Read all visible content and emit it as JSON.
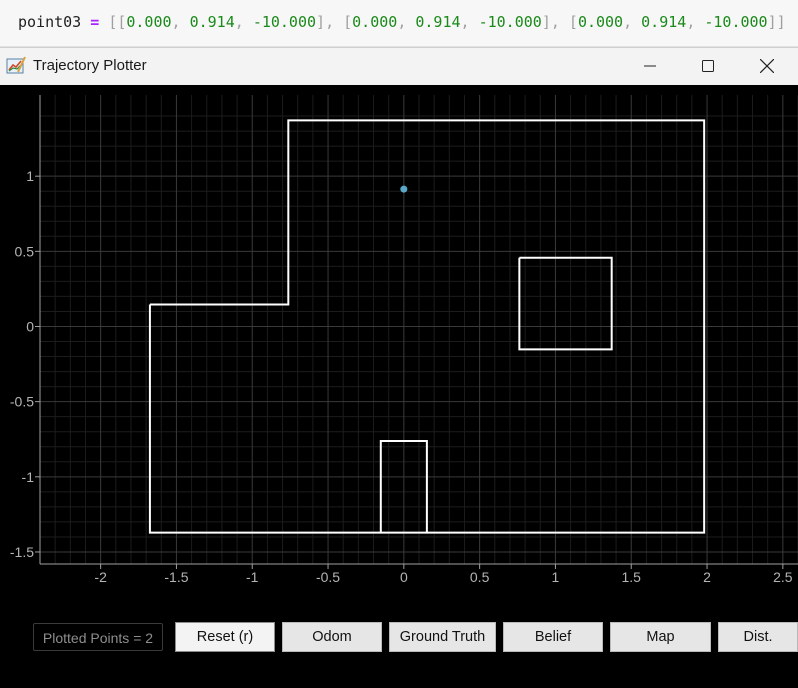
{
  "code_line": {
    "var": "point03",
    "op": " = ",
    "points": [
      [
        "0.000",
        "0.914",
        "-10.000"
      ],
      [
        "0.000",
        "0.914",
        "-10.000"
      ],
      [
        "0.000",
        "0.914",
        "-10.000"
      ]
    ]
  },
  "window": {
    "title": "Trajectory Plotter",
    "app_icon": "chart-pen-icon",
    "controls": [
      "minimize-icon",
      "maximize-icon",
      "close-icon"
    ]
  },
  "chart_data": {
    "type": "line",
    "xlim": [
      -2.4,
      2.6
    ],
    "ylim": [
      -1.58,
      1.54
    ],
    "x_ticks": [
      -2,
      -1.5,
      -1,
      -0.5,
      0,
      0.5,
      1,
      1.5,
      2,
      2.5
    ],
    "x_tick_labels": [
      "-2",
      "-1.5",
      "-1",
      "-0.5",
      "0",
      "0.5",
      "1",
      "1.5",
      "2",
      "2.5"
    ],
    "y_ticks": [
      1,
      0.5,
      0,
      -0.5,
      -1,
      -1.5
    ],
    "y_tick_labels": [
      "1",
      "0.5",
      "0",
      "-0.5",
      "-1",
      "-1.5"
    ],
    "grid": true,
    "map_lines": [
      [
        [
          -1.675,
          0.146
        ],
        [
          -0.762,
          0.146
        ],
        [
          -0.762,
          1.371
        ],
        [
          1.981,
          1.371
        ],
        [
          1.981,
          -1.371
        ],
        [
          -1.675,
          -1.371
        ],
        [
          -1.675,
          0.146
        ]
      ],
      [
        [
          0.762,
          0.457
        ],
        [
          1.371,
          0.457
        ],
        [
          1.371,
          -0.152
        ],
        [
          0.762,
          -0.152
        ],
        [
          0.762,
          0.457
        ]
      ],
      [
        [
          -0.152,
          -1.371
        ],
        [
          -0.152,
          -0.762
        ],
        [
          0.152,
          -0.762
        ],
        [
          0.152,
          -1.371
        ]
      ]
    ],
    "points": [
      {
        "x": 0.0,
        "y": 0.914
      }
    ],
    "colors": {
      "background": "#000000",
      "grid": "#3a3a3a",
      "axis": "#a0a0a0",
      "map": "#ffffff",
      "point": "#5aa8c8"
    }
  },
  "controls": {
    "status": "Plotted Points = 2",
    "buttons": [
      {
        "name": "reset-button",
        "label": "Reset (r)"
      },
      {
        "name": "odom-button",
        "label": "Odom"
      },
      {
        "name": "ground-truth-button",
        "label": "Ground Truth"
      },
      {
        "name": "belief-button",
        "label": "Belief"
      },
      {
        "name": "map-button",
        "label": "Map"
      },
      {
        "name": "dist-button",
        "label": "Dist."
      }
    ]
  }
}
